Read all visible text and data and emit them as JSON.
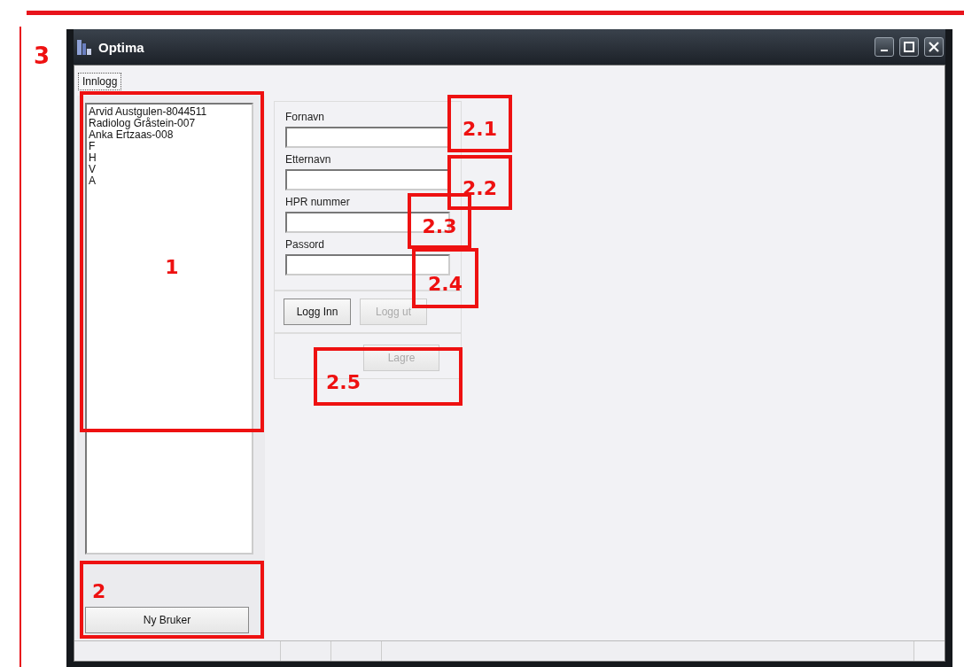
{
  "window": {
    "title": "Optima"
  },
  "tabs": [
    {
      "label": "Innlogg",
      "selected": true
    }
  ],
  "users": [
    {
      "name": "Arvid Austgulen-8044511"
    },
    {
      "name": "Radiolog Gråstein-007"
    },
    {
      "name": "Anka Ertzaas-008"
    },
    {
      "name": "F"
    },
    {
      "name": "H"
    },
    {
      "name": "V"
    },
    {
      "name": "A"
    }
  ],
  "new_user_button": {
    "label": "Ny Bruker",
    "disabled": false
  },
  "fields": [
    {
      "label": "Fornavn"
    },
    {
      "label": "Etternavn"
    },
    {
      "label": "HPR nummer"
    },
    {
      "label": "Passord"
    }
  ],
  "login_buttons": [
    {
      "label": "Logg Inn",
      "disabled": false
    },
    {
      "label": "Logg ut",
      "disabled": true
    }
  ],
  "save_button": {
    "label": "Lagre",
    "disabled": true
  },
  "annotations": [
    {
      "label": "3"
    },
    {
      "label": "1"
    },
    {
      "label": "2"
    },
    {
      "label": "2.1"
    },
    {
      "label": "2.2"
    },
    {
      "label": "2.3"
    },
    {
      "label": "2.4"
    },
    {
      "label": "2.5"
    }
  ]
}
